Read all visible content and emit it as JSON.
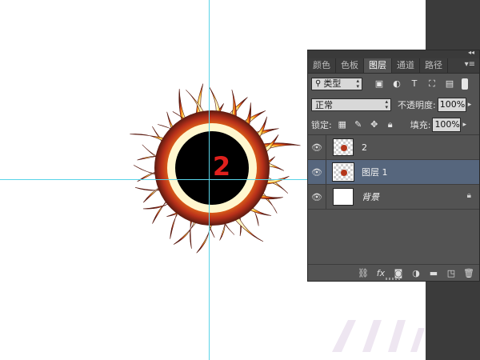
{
  "canvas": {
    "number_label": "2",
    "colors": {
      "guide": "#59d4e8",
      "number": "#e0201d",
      "flame_outer": "#c2321a",
      "flame_inner": "#ffd64a"
    }
  },
  "panel": {
    "tabs": [
      {
        "label": "颜色"
      },
      {
        "label": "色板"
      },
      {
        "label": "图层"
      },
      {
        "label": "通道"
      },
      {
        "label": "路径"
      }
    ],
    "active_tab": "图层",
    "filter": {
      "kind_label": "类型"
    },
    "blend_mode": "正常",
    "opacity_label": "不透明度:",
    "opacity_value": "100%",
    "lock_label": "锁定:",
    "fill_label": "填充:",
    "fill_value": "100%",
    "layers": [
      {
        "name": "2",
        "selected": false
      },
      {
        "name": "图层 1",
        "selected": true
      },
      {
        "name": "背景",
        "selected": false,
        "locked": true
      }
    ],
    "footer_icons": [
      "link-icon",
      "fx-icon",
      "mask-icon",
      "adjustment-icon",
      "group-folder-icon",
      "new-layer-icon",
      "trash-icon"
    ]
  }
}
